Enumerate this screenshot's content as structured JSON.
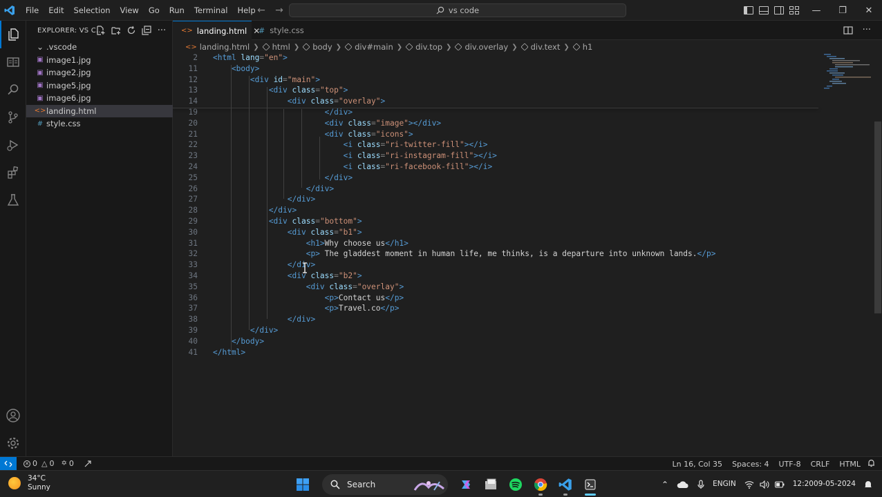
{
  "menubar": [
    "File",
    "Edit",
    "Selection",
    "View",
    "Go",
    "Run",
    "Terminal",
    "Help"
  ],
  "command_center": {
    "text": "vs code"
  },
  "sidebar": {
    "title": "EXPLORER: VS C...",
    "files": [
      {
        "name": ".vscode",
        "kind": "folder"
      },
      {
        "name": "image1.jpg",
        "kind": "image"
      },
      {
        "name": "image2.jpg",
        "kind": "image"
      },
      {
        "name": "image5.jpg",
        "kind": "image"
      },
      {
        "name": "image6.jpg",
        "kind": "image"
      },
      {
        "name": "landing.html",
        "kind": "html"
      },
      {
        "name": "style.css",
        "kind": "css"
      }
    ]
  },
  "tabs": [
    {
      "label": "landing.html",
      "kind": "html"
    },
    {
      "label": "style.css",
      "kind": "css"
    }
  ],
  "breadcrumbs": [
    "landing.html",
    "html",
    "body",
    "div#main",
    "div.top",
    "div.overlay",
    "div.text",
    "h1"
  ],
  "code": [
    {
      "ln": "2",
      "tokens": [
        [
          "tag",
          "<html"
        ],
        [
          "attr",
          " lang"
        ],
        [
          "pun",
          "="
        ],
        [
          "str",
          "\"en\""
        ],
        [
          "tag",
          ">"
        ]
      ]
    },
    {
      "ln": "11",
      "tokens": [
        [
          "tag",
          "    <body>"
        ]
      ]
    },
    {
      "ln": "12",
      "tokens": [
        [
          "tag",
          "        <div"
        ],
        [
          "attr",
          " id"
        ],
        [
          "pun",
          "="
        ],
        [
          "str",
          "\"main\""
        ],
        [
          "tag",
          ">"
        ]
      ]
    },
    {
      "ln": "13",
      "tokens": [
        [
          "tag",
          "            <div"
        ],
        [
          "attr",
          " class"
        ],
        [
          "pun",
          "="
        ],
        [
          "str",
          "\"top\""
        ],
        [
          "tag",
          ">"
        ]
      ]
    },
    {
      "ln": "14",
      "tokens": [
        [
          "tag",
          "                <div"
        ],
        [
          "attr",
          " class"
        ],
        [
          "pun",
          "="
        ],
        [
          "str",
          "\"overlay\""
        ],
        [
          "tag",
          ">"
        ]
      ]
    },
    {
      "ln": "19",
      "tokens": [
        [
          "tag",
          "                        </div>"
        ]
      ]
    },
    {
      "ln": "20",
      "tokens": [
        [
          "tag",
          "                        <div"
        ],
        [
          "attr",
          " class"
        ],
        [
          "pun",
          "="
        ],
        [
          "str",
          "\"image\""
        ],
        [
          "tag",
          "></div>"
        ]
      ]
    },
    {
      "ln": "21",
      "tokens": [
        [
          "tag",
          "                        <div"
        ],
        [
          "attr",
          " class"
        ],
        [
          "pun",
          "="
        ],
        [
          "str",
          "\"icons\""
        ],
        [
          "tag",
          ">"
        ]
      ]
    },
    {
      "ln": "22",
      "tokens": [
        [
          "tag",
          "                            <i"
        ],
        [
          "attr",
          " class"
        ],
        [
          "pun",
          "="
        ],
        [
          "str",
          "\"ri-twitter-fill\""
        ],
        [
          "tag",
          "></i>"
        ]
      ]
    },
    {
      "ln": "23",
      "tokens": [
        [
          "tag",
          "                            <i"
        ],
        [
          "attr",
          " class"
        ],
        [
          "pun",
          "="
        ],
        [
          "str",
          "\"ri-instagram-fill\""
        ],
        [
          "tag",
          "></i>"
        ]
      ]
    },
    {
      "ln": "24",
      "tokens": [
        [
          "tag",
          "                            <i"
        ],
        [
          "attr",
          " class"
        ],
        [
          "pun",
          "="
        ],
        [
          "str",
          "\"ri-facebook-fill\""
        ],
        [
          "tag",
          "></i>"
        ]
      ]
    },
    {
      "ln": "25",
      "tokens": [
        [
          "tag",
          "                        </div>"
        ]
      ]
    },
    {
      "ln": "26",
      "tokens": [
        [
          "tag",
          "                    </div>"
        ]
      ]
    },
    {
      "ln": "27",
      "tokens": [
        [
          "tag",
          "                </div>"
        ]
      ]
    },
    {
      "ln": "28",
      "tokens": [
        [
          "tag",
          "            </div>"
        ]
      ]
    },
    {
      "ln": "29",
      "tokens": [
        [
          "tag",
          "            <div"
        ],
        [
          "attr",
          " class"
        ],
        [
          "pun",
          "="
        ],
        [
          "str",
          "\"bottom\""
        ],
        [
          "tag",
          ">"
        ]
      ]
    },
    {
      "ln": "30",
      "tokens": [
        [
          "tag",
          "                <div"
        ],
        [
          "attr",
          " class"
        ],
        [
          "pun",
          "="
        ],
        [
          "str",
          "\"b1\""
        ],
        [
          "tag",
          ">"
        ]
      ]
    },
    {
      "ln": "31",
      "tokens": [
        [
          "tag",
          "                    <h1>"
        ],
        [
          "txt",
          "Why choose us"
        ],
        [
          "tag",
          "</h1>"
        ]
      ]
    },
    {
      "ln": "32",
      "tokens": [
        [
          "tag",
          "                    <p>"
        ],
        [
          "txt",
          " The gladdest moment in human life, me thinks, is a departure into unknown lands."
        ],
        [
          "tag",
          "</p>"
        ]
      ]
    },
    {
      "ln": "33",
      "tokens": [
        [
          "tag",
          "                </div>"
        ]
      ]
    },
    {
      "ln": "34",
      "tokens": [
        [
          "tag",
          "                <div"
        ],
        [
          "attr",
          " class"
        ],
        [
          "pun",
          "="
        ],
        [
          "str",
          "\"b2\""
        ],
        [
          "tag",
          ">"
        ]
      ]
    },
    {
      "ln": "35",
      "tokens": [
        [
          "tag",
          "                    <div"
        ],
        [
          "attr",
          " class"
        ],
        [
          "pun",
          "="
        ],
        [
          "str",
          "\"overlay\""
        ],
        [
          "tag",
          ">"
        ]
      ]
    },
    {
      "ln": "36",
      "tokens": [
        [
          "tag",
          "                        <p>"
        ],
        [
          "txt",
          "Contact us"
        ],
        [
          "tag",
          "</p>"
        ]
      ]
    },
    {
      "ln": "37",
      "tokens": [
        [
          "tag",
          "                        <p>"
        ],
        [
          "txt",
          "Travel.co"
        ],
        [
          "tag",
          "</p>"
        ]
      ]
    },
    {
      "ln": "38",
      "tokens": [
        [
          "tag",
          "                </div>"
        ]
      ]
    },
    {
      "ln": "39",
      "tokens": [
        [
          "tag",
          "        </div>"
        ]
      ]
    },
    {
      "ln": "40",
      "tokens": [
        [
          "tag",
          "    </body>"
        ]
      ]
    },
    {
      "ln": "41",
      "tokens": [
        [
          "tag",
          "</html>"
        ]
      ]
    }
  ],
  "statusbar": {
    "errors": "0",
    "warnings": "0",
    "ports": "0",
    "position": "Ln 16, Col 35",
    "spaces": "Spaces: 4",
    "encoding": "UTF-8",
    "eol": "CRLF",
    "language": "HTML"
  },
  "taskbar": {
    "temperature": "34°C",
    "weather": "Sunny",
    "search": "Search",
    "lang1": "ENG",
    "lang2": "IN",
    "time": "12:20",
    "date": "09-05-2024"
  },
  "colors": {
    "accent": "#0078d4",
    "tag": "#569cd6",
    "attr": "#9cdcfe",
    "string": "#ce9178"
  }
}
